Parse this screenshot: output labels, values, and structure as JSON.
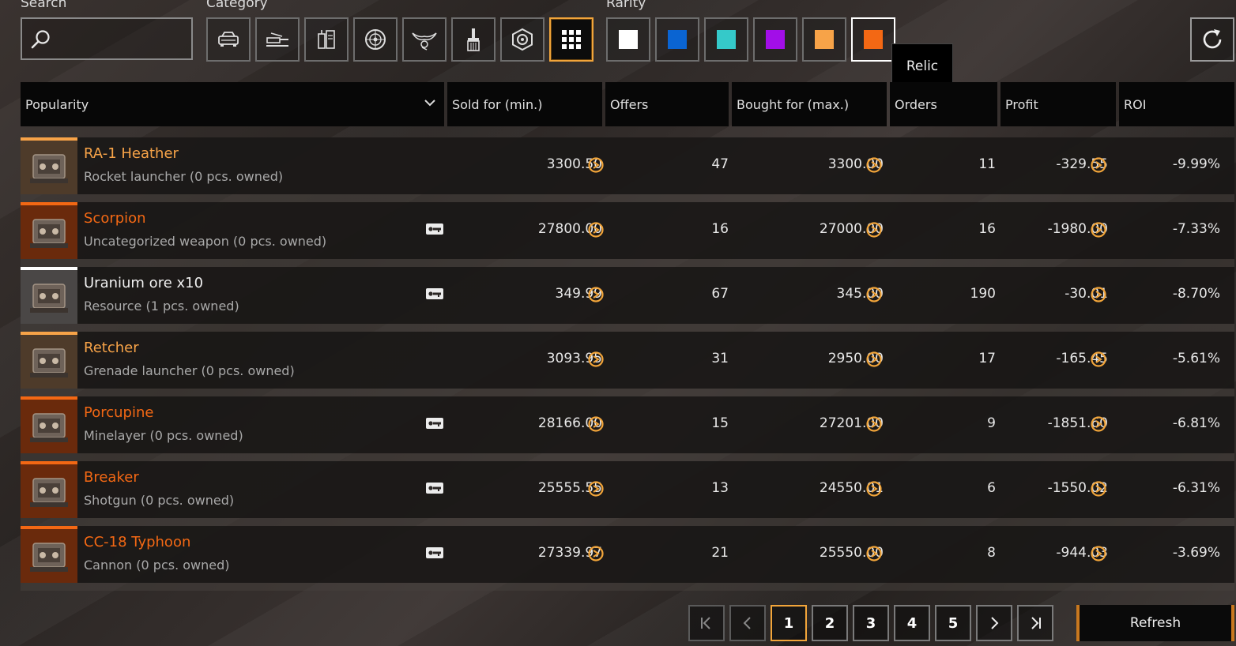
{
  "filters": {
    "search_label": "Search",
    "search_value": "",
    "category_label": "Category",
    "rarity_label": "Rarity",
    "categories": [
      {
        "icon": "car-icon"
      },
      {
        "icon": "gun-icon"
      },
      {
        "icon": "engine-icon"
      },
      {
        "icon": "wheel-icon"
      },
      {
        "icon": "wings-icon"
      },
      {
        "icon": "paintbrush-icon"
      },
      {
        "icon": "hexagon-gear-icon"
      },
      {
        "icon": "grid-icon",
        "active": true
      }
    ],
    "rarities": [
      {
        "color": "#ffffff"
      },
      {
        "color": "#0a64d2"
      },
      {
        "color": "#35c9c9"
      },
      {
        "color": "#a20ee8"
      },
      {
        "color": "#f7a348"
      },
      {
        "color": "#f36814",
        "active": true
      }
    ],
    "tooltip": "Relic"
  },
  "headers": {
    "sort": "Popularity",
    "sold": "Sold for (min.)",
    "offers": "Offers",
    "bought": "Bought for (max.)",
    "orders": "Orders",
    "profit": "Profit",
    "roi": "ROI"
  },
  "rows": [
    {
      "name": "RA-1 Heather",
      "sub": "Rocket launcher (0 pcs. owned)",
      "sold": "3300.50",
      "offers": "47",
      "bought": "3300.00",
      "orders": "11",
      "profit": "-329.55",
      "roi": "-9.99%",
      "rarity_color": "#f7a348",
      "tradeable": false
    },
    {
      "name": "Scorpion",
      "sub": "Uncategorized weapon (0 pcs. owned)",
      "sold": "27800.00",
      "offers": "16",
      "bought": "27000.00",
      "orders": "16",
      "profit": "-1980.00",
      "roi": "-7.33%",
      "rarity_color": "#f36814",
      "tradeable": true
    },
    {
      "name": "Uranium ore x10",
      "sub": "Resource (1 pcs. owned)",
      "sold": "349.99",
      "offers": "67",
      "bought": "345.00",
      "orders": "190",
      "profit": "-30.01",
      "roi": "-8.70%",
      "rarity_color": "#ffffff",
      "tradeable": true
    },
    {
      "name": "Retcher",
      "sub": "Grenade launcher (0 pcs. owned)",
      "sold": "3093.95",
      "offers": "31",
      "bought": "2950.00",
      "orders": "17",
      "profit": "-165.45",
      "roi": "-5.61%",
      "rarity_color": "#f7a348",
      "tradeable": false
    },
    {
      "name": "Porcupine",
      "sub": "Minelayer (0 pcs. owned)",
      "sold": "28166.00",
      "offers": "15",
      "bought": "27201.00",
      "orders": "9",
      "profit": "-1851.60",
      "roi": "-6.81%",
      "rarity_color": "#f36814",
      "tradeable": true
    },
    {
      "name": "Breaker",
      "sub": "Shotgun (0 pcs. owned)",
      "sold": "25555.55",
      "offers": "13",
      "bought": "24550.01",
      "orders": "6",
      "profit": "-1550.02",
      "roi": "-6.31%",
      "rarity_color": "#f36814",
      "tradeable": true
    },
    {
      "name": "CC-18 Typhoon",
      "sub": "Cannon (0 pcs. owned)",
      "sold": "27339.97",
      "offers": "21",
      "bought": "25550.00",
      "orders": "8",
      "profit": "-944.03",
      "roi": "-3.69%",
      "rarity_color": "#f36814",
      "tradeable": true
    }
  ],
  "pagination": {
    "pages": [
      "1",
      "2",
      "3",
      "4",
      "5"
    ],
    "current": "1"
  },
  "refresh_label": "Refresh"
}
